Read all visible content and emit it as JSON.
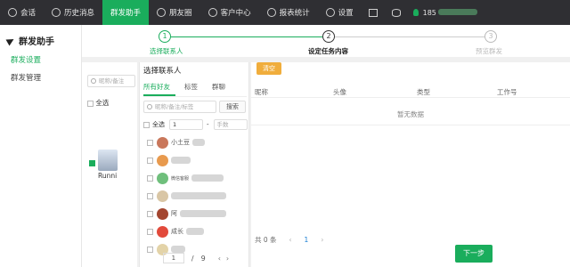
{
  "nav": {
    "items": [
      {
        "label": "会话",
        "icon": "chat-icon"
      },
      {
        "label": "历史消息",
        "icon": "clock-icon"
      },
      {
        "label": "群发助手",
        "icon": "",
        "active": true
      },
      {
        "label": "朋友圈",
        "icon": "camera-icon"
      },
      {
        "label": "客户中心",
        "icon": "user-icon"
      },
      {
        "label": "报表统计",
        "icon": "bar-chart-icon"
      },
      {
        "label": "设置",
        "icon": "gear-icon"
      }
    ],
    "account_prefix": "185"
  },
  "sidebar": {
    "title": "群发助手",
    "items": [
      {
        "label": "群发设置",
        "active": true
      },
      {
        "label": "群发管理"
      }
    ]
  },
  "steps": [
    {
      "num": "1",
      "label": "选择联系人",
      "state": "done"
    },
    {
      "num": "2",
      "label": "设定任务内容",
      "state": "current"
    },
    {
      "num": "3",
      "label": "预览群发",
      "state": "todo"
    }
  ],
  "left_panel": {
    "search_placeholder": "昵称/备注",
    "select_all": "全选",
    "group_name": "Runni"
  },
  "chooser": {
    "title": "选择联系人",
    "tabs": [
      "所有好友",
      "标签",
      "群聊"
    ],
    "search_placeholder": "昵称/备注/标签",
    "search_button": "搜索",
    "select_all": "全选",
    "range_from": "1",
    "range_sep": "-",
    "range_to_placeholder": "手数",
    "contacts": [
      {
        "name": "小土豆",
        "avatar_color": "#c9775b"
      },
      {
        "name": "",
        "avatar_color": "#e89a4e"
      },
      {
        "name": "微信客服",
        "avatar_color": "#6fbf7c"
      },
      {
        "name": "",
        "avatar_color": "#d9c6a5"
      },
      {
        "name": "阿",
        "avatar_color": "#a3452f"
      },
      {
        "name": "成长",
        "avatar_color": "#e24a3b"
      },
      {
        "name": "",
        "avatar_color": "#e3d3a8"
      }
    ],
    "page_current": "1",
    "page_sep": "/",
    "page_total": "9",
    "prev_arrow": "‹",
    "next_arrow": "›"
  },
  "content": {
    "clear_button": "清空",
    "columns": [
      "昵称",
      "头像",
      "类型",
      "工作号"
    ],
    "empty_text": "暂无数据",
    "total_text": "共 0 条",
    "page": "1",
    "prev_arrow": "‹",
    "next_arrow": "›",
    "next_button": "下一步"
  },
  "colors": {
    "accent": "#1aad5c",
    "warn": "#f0ad3c",
    "nav_bg": "#2f2f33"
  }
}
